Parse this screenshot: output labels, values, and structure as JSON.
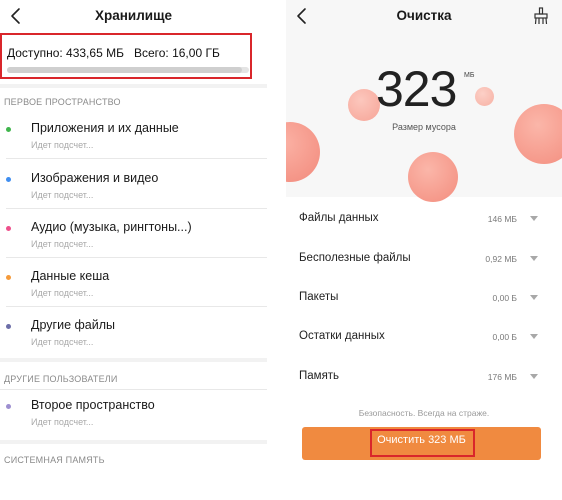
{
  "left": {
    "title": "Хранилище",
    "storage": {
      "available": "Доступно: 433,65 МБ",
      "total": "Всего: 16,00 ГБ",
      "used_fraction": 0.97
    },
    "sections": [
      {
        "label": "ПЕРВОЕ ПРОСТРАНСТВО",
        "items": [
          {
            "title": "Приложения и их данные",
            "subtitle": "Идет подсчет...",
            "color": "#3fb54c"
          },
          {
            "title": "Изображения и видео",
            "subtitle": "Идет подсчет...",
            "color": "#3f8ef0"
          },
          {
            "title": "Аудио (музыка, рингтоны...)",
            "subtitle": "Идет подсчет...",
            "color": "#ee4f8b"
          },
          {
            "title": "Данные кеша",
            "subtitle": "Идет подсчет...",
            "color": "#f59a3a"
          },
          {
            "title": "Другие файлы",
            "subtitle": "Идет подсчет...",
            "color": "#6c6ea8"
          }
        ]
      },
      {
        "label": "ДРУГИЕ ПОЛЬЗОВАТЕЛИ",
        "items": [
          {
            "title": "Второе пространство",
            "subtitle": "Идет подсчет...",
            "color": "#9d8fd0"
          }
        ]
      },
      {
        "label": "СИСТЕМНАЯ ПАМЯТЬ",
        "items": []
      }
    ]
  },
  "right": {
    "title": "Очистка",
    "junk": {
      "value": "323",
      "unit": "МБ",
      "label": "Размер мусора"
    },
    "items": [
      {
        "name": "Файлы данных",
        "value": "146 МБ"
      },
      {
        "name": "Бесполезные файлы",
        "value": "0,92 МБ"
      },
      {
        "name": "Пакеты",
        "value": "0,00 Б"
      },
      {
        "name": "Остатки данных",
        "value": "0,00 Б"
      },
      {
        "name": "Память",
        "value": "176 МБ"
      }
    ],
    "footer_note": "Безопасность. Всегда на страже.",
    "clean_button": "Очистить 323 МБ"
  },
  "colors": {
    "accent_orange": "#f08a40",
    "highlight_red": "#d9262b",
    "bubble_coral": "#f4938a"
  },
  "icons": {
    "back": "chevron-left-icon",
    "cleaner": "broom-icon",
    "expand": "chevron-down-icon"
  }
}
